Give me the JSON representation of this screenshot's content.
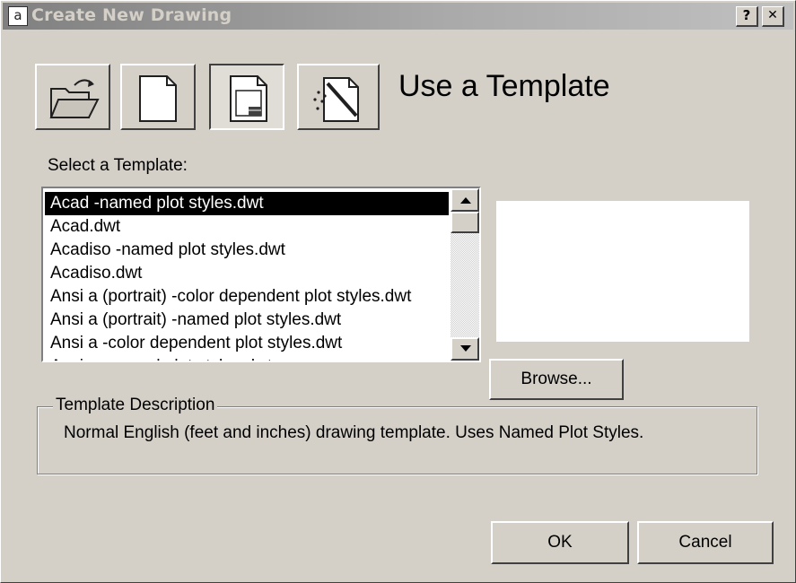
{
  "window": {
    "title": "Create New Drawing",
    "help_label": "?",
    "close_label": "✕"
  },
  "modes": {
    "buttons": [
      {
        "name": "open-drawing",
        "icon": "open-folder-icon"
      },
      {
        "name": "start-from-scratch",
        "icon": "blank-page-icon"
      },
      {
        "name": "use-a-template",
        "icon": "template-page-icon",
        "pressed": true
      },
      {
        "name": "use-a-wizard",
        "icon": "wizard-wand-icon"
      }
    ],
    "heading": "Use a Template"
  },
  "template_list": {
    "label": "Select a Template:",
    "items": [
      {
        "label": "Acad -named plot styles.dwt",
        "selected": true
      },
      {
        "label": "Acad.dwt"
      },
      {
        "label": "Acadiso -named plot styles.dwt"
      },
      {
        "label": "Acadiso.dwt"
      },
      {
        "label": "Ansi a (portrait) -color dependent plot styles.dwt"
      },
      {
        "label": "Ansi a (portrait) -named plot styles.dwt"
      },
      {
        "label": "Ansi a -color dependent plot styles.dwt"
      },
      {
        "label": "Ansi a -named plot styles.dwt"
      }
    ]
  },
  "browse_label": "Browse...",
  "description": {
    "legend": "Template Description",
    "text": "Normal English (feet and inches) drawing template.  Uses Named Plot Styles."
  },
  "footer": {
    "ok_label": "OK",
    "cancel_label": "Cancel"
  }
}
